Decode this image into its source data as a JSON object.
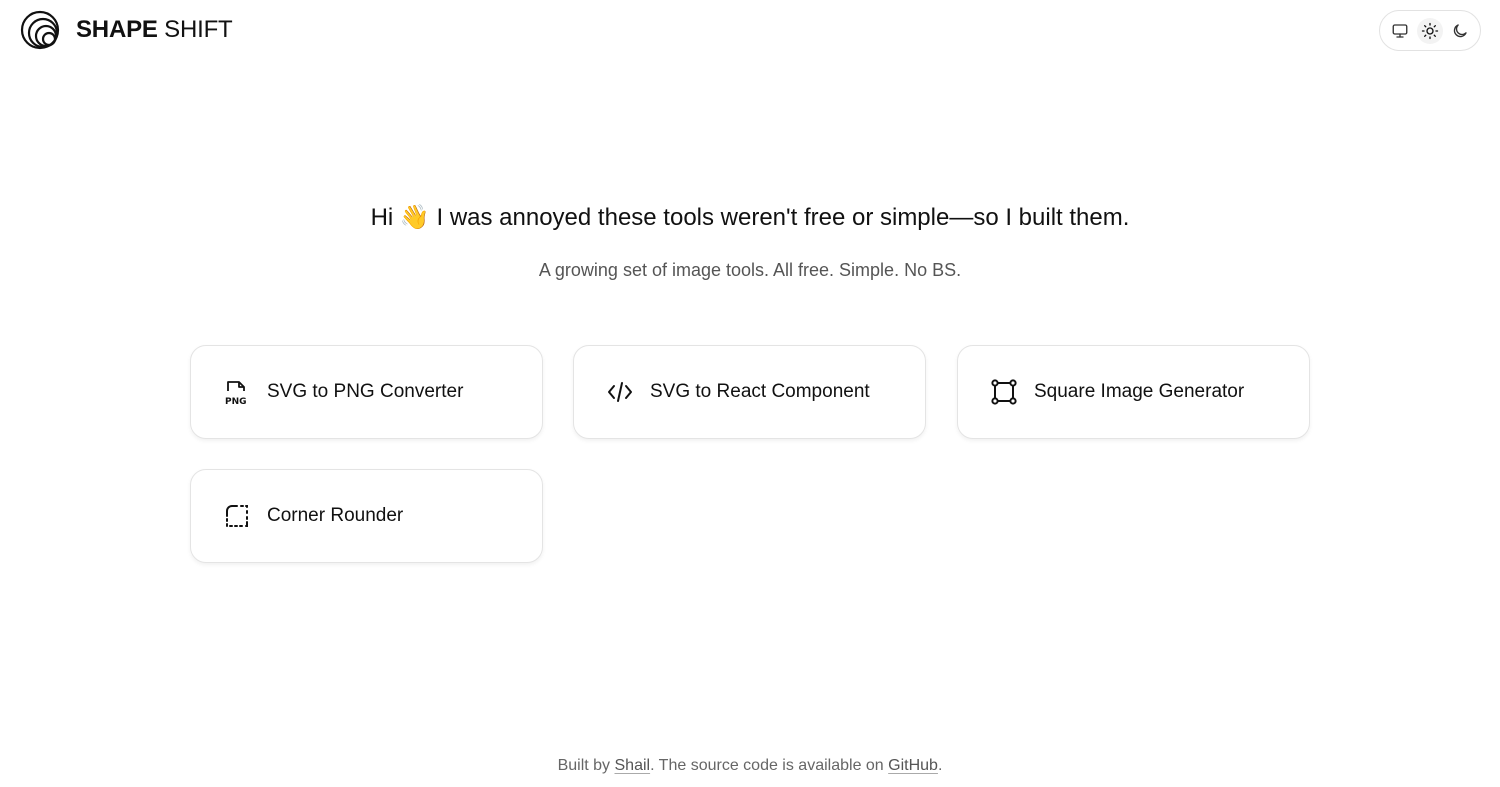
{
  "header": {
    "brand_bold": "SHAPE",
    "brand_light": "SHIFT",
    "logo_icon": "concentric-circles-logo",
    "theme_switch": [
      {
        "name": "system",
        "icon": "monitor-icon",
        "active": false
      },
      {
        "name": "light",
        "icon": "sun-icon",
        "active": true
      },
      {
        "name": "dark",
        "icon": "moon-icon",
        "active": false
      }
    ]
  },
  "hero": {
    "greeting": "Hi",
    "emoji": "👋",
    "title": "I was annoyed these tools weren't free or simple—so I built them.",
    "subtitle": "A growing set of image tools. All free. Simple. No BS."
  },
  "tools": [
    {
      "label": "SVG to PNG Converter",
      "icon": "png-file-icon"
    },
    {
      "label": "SVG to React Component",
      "icon": "code-icon"
    },
    {
      "label": "Square Image Generator",
      "icon": "square-frame-icon"
    },
    {
      "label": "Corner Rounder",
      "icon": "rounded-corner-icon"
    }
  ],
  "footer": {
    "prefix": "Built by",
    "author": "Shail",
    "middle": ". The source code is available on",
    "repo": "GitHub",
    "suffix": "."
  },
  "colors": {
    "text": "#111111",
    "muted": "#555555",
    "border": "#e4e4e4",
    "background": "#ffffff"
  }
}
